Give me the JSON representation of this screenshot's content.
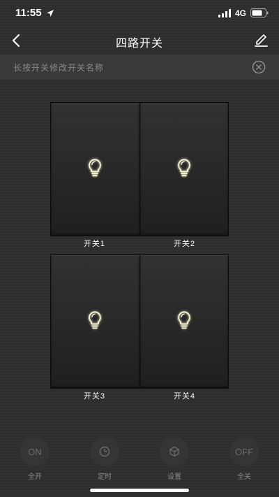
{
  "status_bar": {
    "time": "11:55",
    "network": "4G"
  },
  "header": {
    "title": "四路开关",
    "back_icon": "chevron-left-icon",
    "edit_icon": "pencil-icon"
  },
  "hint": {
    "text": "长按开关修改开关名称",
    "close_icon": "close-circle-icon"
  },
  "switches": [
    {
      "label": "开关1",
      "icon": "lightbulb-icon"
    },
    {
      "label": "开关2",
      "icon": "lightbulb-icon"
    },
    {
      "label": "开关3",
      "icon": "lightbulb-icon"
    },
    {
      "label": "开关4",
      "icon": "lightbulb-icon"
    }
  ],
  "actions": [
    {
      "label": "全开",
      "glyph": "ON"
    },
    {
      "label": "定时",
      "icon": "clock-icon"
    },
    {
      "label": "设置",
      "icon": "cube-icon"
    },
    {
      "label": "全关",
      "glyph": "OFF"
    }
  ],
  "colors": {
    "background": "#2e2e2e",
    "hint_bar": "#3a3a3a",
    "bulb_glow": "#f5eec0"
  }
}
